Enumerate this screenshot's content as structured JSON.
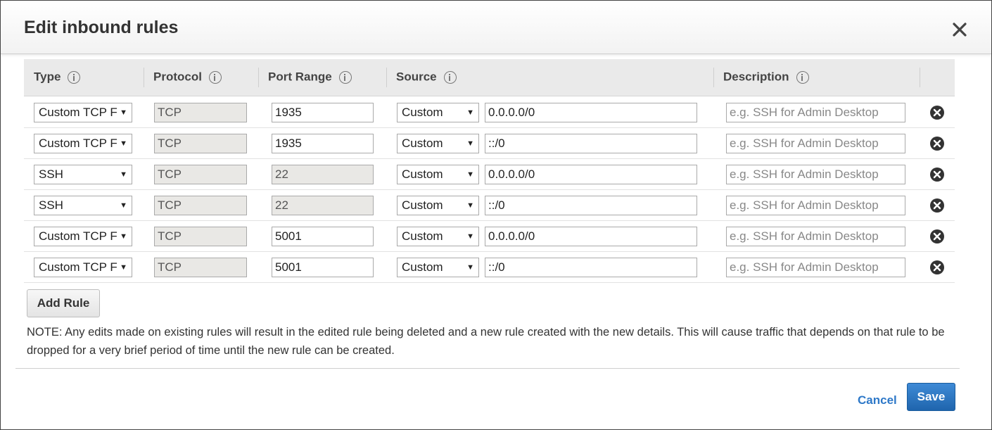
{
  "dialog": {
    "title": "Edit inbound rules",
    "close_icon": "close-icon"
  },
  "columns": {
    "type": "Type",
    "protocol": "Protocol",
    "port_range": "Port Range",
    "source": "Source",
    "description": "Description",
    "info_icon": "info-icon"
  },
  "rules": [
    {
      "type": "Custom TCP F",
      "protocol": "TCP",
      "port": "1935",
      "source_type": "Custom",
      "source": "0.0.0.0/0",
      "description_placeholder": "e.g. SSH for Admin Desktop"
    },
    {
      "type": "Custom TCP F",
      "protocol": "TCP",
      "port": "1935",
      "source_type": "Custom",
      "source": "::/0",
      "description_placeholder": "e.g. SSH for Admin Desktop"
    },
    {
      "type": "SSH",
      "protocol": "TCP",
      "port": "22",
      "source_type": "Custom",
      "source": "0.0.0.0/0",
      "description_placeholder": "e.g. SSH for Admin Desktop"
    },
    {
      "type": "SSH",
      "protocol": "TCP",
      "port": "22",
      "source_type": "Custom",
      "source": "::/0",
      "description_placeholder": "e.g. SSH for Admin Desktop"
    },
    {
      "type": "Custom TCP F",
      "protocol": "TCP",
      "port": "5001",
      "source_type": "Custom",
      "source": "0.0.0.0/0",
      "description_placeholder": "e.g. SSH for Admin Desktop"
    },
    {
      "type": "Custom TCP F",
      "protocol": "TCP",
      "port": "5001",
      "source_type": "Custom",
      "source": "::/0",
      "description_placeholder": "e.g. SSH for Admin Desktop"
    }
  ],
  "actions": {
    "add_rule": "Add Rule",
    "note": "NOTE: Any edits made on existing rules will result in the edited rule being deleted and a new rule created with the new details. This will cause traffic that depends on that rule to be dropped for a very brief period of time until the new rule can be created.",
    "cancel": "Cancel",
    "save": "Save"
  },
  "colors": {
    "accent": "#2d78c8",
    "save_button": "#1f65ad",
    "header_bg": "#eaeaea",
    "disabled_field": "#e9e8e5"
  }
}
